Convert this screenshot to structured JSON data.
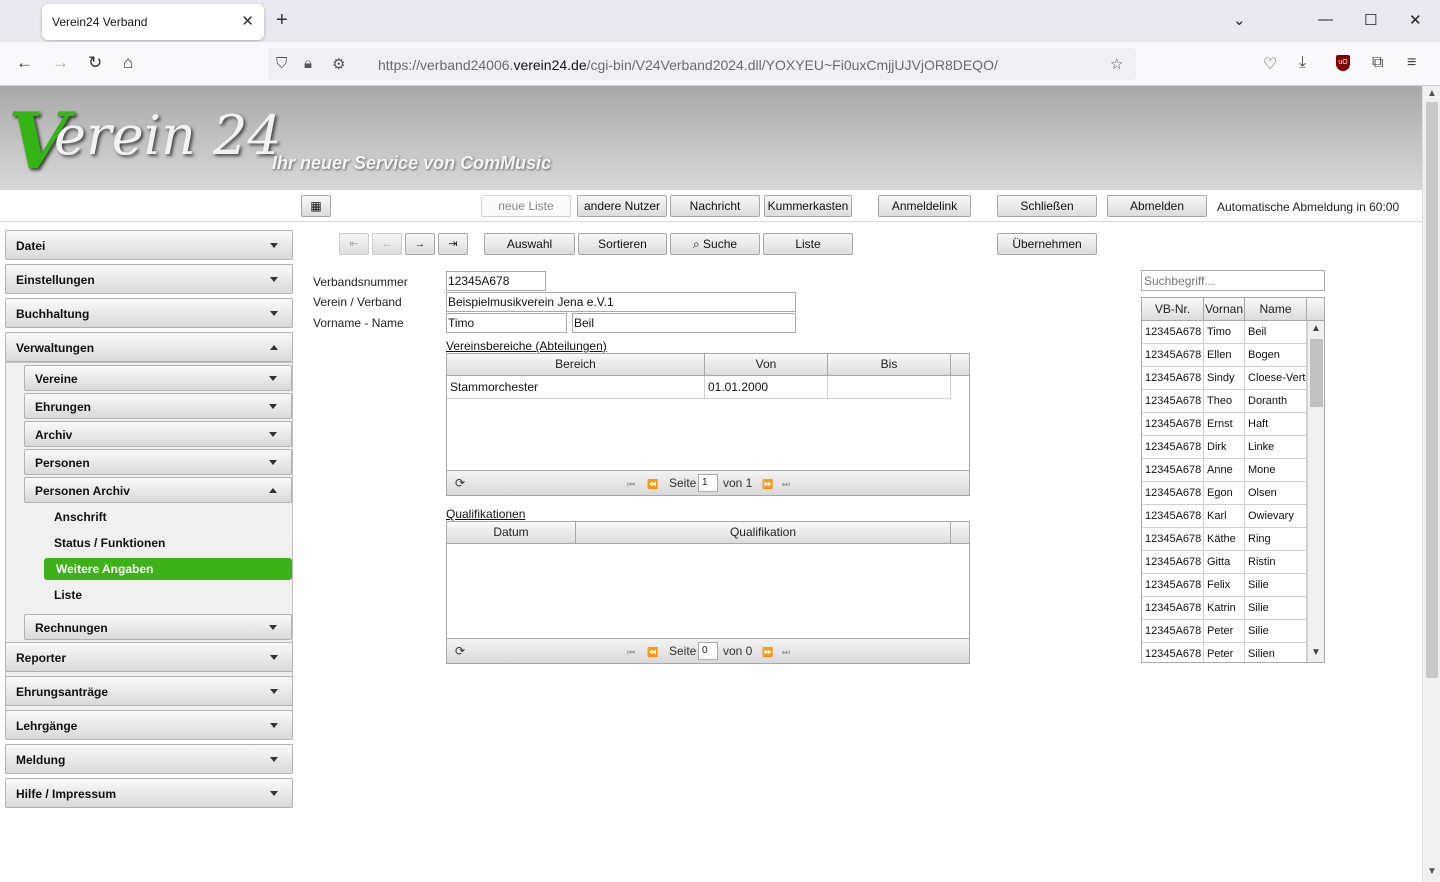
{
  "browser": {
    "tab_title": "Verein24 Verband",
    "url_prefix": "https://verband24006.",
    "url_domain": "verein24.de",
    "url_path": "/cgi-bin/V24Verband2024.dll/YOXYEU~Fi0uxCmjjUJVjOR8DEQO/"
  },
  "banner": {
    "logo_initial": "V",
    "logo_text": "erein 24",
    "slogan": "Ihr neuer Service von ComMusic"
  },
  "toolbar": {
    "neue_liste": "neue Liste",
    "andere_nutzer": "andere Nutzer",
    "nachricht": "Nachricht",
    "kummerkasten": "Kummerkasten",
    "anmeldelink": "Anmeldelink",
    "schliessen": "Schließen",
    "abmelden": "Abmelden",
    "auto_logout": "Automatische Abmeldung in 60:00"
  },
  "sidebar": {
    "datei": "Datei",
    "einstellungen": "Einstellungen",
    "buchhaltung": "Buchhaltung",
    "verwaltungen": "Verwaltungen",
    "vereine": "Vereine",
    "ehrungen": "Ehrungen",
    "archiv": "Archiv",
    "personen": "Personen",
    "personen_archiv": "Personen Archiv",
    "anschrift": "Anschrift",
    "status_funktionen": "Status / Funktionen",
    "weitere_angaben": "Weitere Angaben",
    "liste": "Liste",
    "rechnungen": "Rechnungen",
    "reporter": "Reporter",
    "ehrungsantraege": "Ehrungsanträge",
    "lehrgaenge": "Lehrgänge",
    "meldung": "Meldung",
    "hilfe": "Hilfe / Impressum"
  },
  "actions": {
    "auswahl": "Auswahl",
    "sortieren": "Sortieren",
    "suche": "Suche",
    "liste": "Liste",
    "uebernehmen": "Übernehmen"
  },
  "form": {
    "verbandsnummer_label": "Verbandsnummer",
    "verbandsnummer": "12345A678",
    "verein_label": "Verein / Verband",
    "verein": "Beispielmusikverein Jena e.V.1",
    "name_label": "Vorname - Name",
    "vorname": "Timo",
    "nachname": "Beil"
  },
  "vereinsbereiche": {
    "title": "Vereinsbereiche (Abteilungen)",
    "columns": [
      "Bereich",
      "Von",
      "Bis"
    ],
    "rows": [
      {
        "bereich": "Stammorchester",
        "von": "01.01.2000",
        "bis": ""
      }
    ],
    "page_label": "Seite",
    "page": "1",
    "of_label": "von 1"
  },
  "qualifikationen": {
    "title": "Qualifikationen",
    "columns": [
      "Datum",
      "Qualifikation"
    ],
    "page_label": "Seite",
    "page": "0",
    "of_label": "von 0"
  },
  "search": {
    "placeholder": "Suchbegriff..."
  },
  "people_list": {
    "columns": [
      "VB-Nr.",
      "Vornan",
      "Name"
    ],
    "rows": [
      {
        "nr": "12345A678",
        "vorname": "Timo",
        "name": "Beil"
      },
      {
        "nr": "12345A678",
        "vorname": "Ellen",
        "name": "Bogen"
      },
      {
        "nr": "12345A678",
        "vorname": "Sindy",
        "name": "Cloese-Vert"
      },
      {
        "nr": "12345A678",
        "vorname": "Theo",
        "name": "Doranth"
      },
      {
        "nr": "12345A678",
        "vorname": "Ernst",
        "name": "Haft"
      },
      {
        "nr": "12345A678",
        "vorname": "Dirk",
        "name": "Linke"
      },
      {
        "nr": "12345A678",
        "vorname": "Anne",
        "name": "Mone"
      },
      {
        "nr": "12345A678",
        "vorname": "Egon",
        "name": "Olsen"
      },
      {
        "nr": "12345A678",
        "vorname": "Karl",
        "name": "Owievary"
      },
      {
        "nr": "12345A678",
        "vorname": "Käthe",
        "name": "Ring"
      },
      {
        "nr": "12345A678",
        "vorname": "Gitta",
        "name": "Ristin"
      },
      {
        "nr": "12345A678",
        "vorname": "Felix",
        "name": "Silie"
      },
      {
        "nr": "12345A678",
        "vorname": "Katrin",
        "name": "Silie"
      },
      {
        "nr": "12345A678",
        "vorname": "Peter",
        "name": "Silie"
      },
      {
        "nr": "12345A678",
        "vorname": "Peter",
        "name": "Silien"
      }
    ]
  },
  "colors": {
    "accent": "#3cb218",
    "logo_green": "#35b515"
  }
}
